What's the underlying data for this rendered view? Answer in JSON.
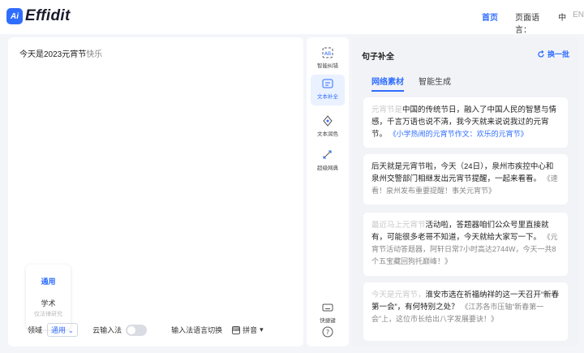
{
  "header": {
    "logo_badge": "Ai",
    "logo_text": "Effidit",
    "nav_home": "首页",
    "lang_label": "页面语言：",
    "lang_zh": "中",
    "lang_en": "EN"
  },
  "editor": {
    "text": "今天是2023元宵节",
    "hint": "快乐",
    "domain_card": {
      "title": "通用",
      "subject": "学术",
      "note": "仅法律研究"
    },
    "field_label": "领域",
    "field_value": "通用",
    "cloud_input_label": "云输入法",
    "cloud_input_on": false,
    "ime_switch_label": "输入法语言切换",
    "ime_lang": "拼音"
  },
  "tools": [
    {
      "label": "智能纠错",
      "icon": "ai-correct-icon"
    },
    {
      "label": "文本补全",
      "icon": "text-complete-icon"
    },
    {
      "label": "文本润色",
      "icon": "polish-icon"
    },
    {
      "label": "超级网典",
      "icon": "dictionary-icon"
    },
    {
      "label": "快捷键",
      "icon": "keyboard-icon"
    },
    {
      "label": "?",
      "icon": "help-icon"
    }
  ],
  "panel": {
    "title": "句子补全",
    "refresh": "换一批",
    "tabs": [
      "网络素材",
      "智能生成"
    ],
    "cards": [
      {
        "lead": "元宵节是",
        "body": "中国的传统节日，融入了中国人民的智慧与情感，千言万语也说不清，我今天就来说说我过的元宵节。",
        "source": "《小学热闹的元宵节作文：欢乐的元宵节》"
      },
      {
        "lead": "",
        "body": "后天就是元宵节啦，今天（24日），泉州市疾控中心和泉州交警部门相继发出元宵节提醒，一起来看看。",
        "source": "《速看！泉州发布重要提醒！事关元宵节》"
      },
      {
        "lead": "最近马上元宵节",
        "body": "活动啦，答题器咱们公众号里直接就有，可能很多老哥不知道，今天就给大家写一下。",
        "source": "《元宵节活动答题器，阿轩日常7小时高达2744W，今天一共8个五宝藏回狗托巅峰！》"
      },
      {
        "lead": "今天是元宵节，",
        "body": "淮安市选在祈福纳祥的这一天召开“新春第一会”，有何特别之处？",
        "source": "《江苏各市压轴“新春第一会”上，这位市长给出八字发展要诀！》"
      }
    ]
  }
}
